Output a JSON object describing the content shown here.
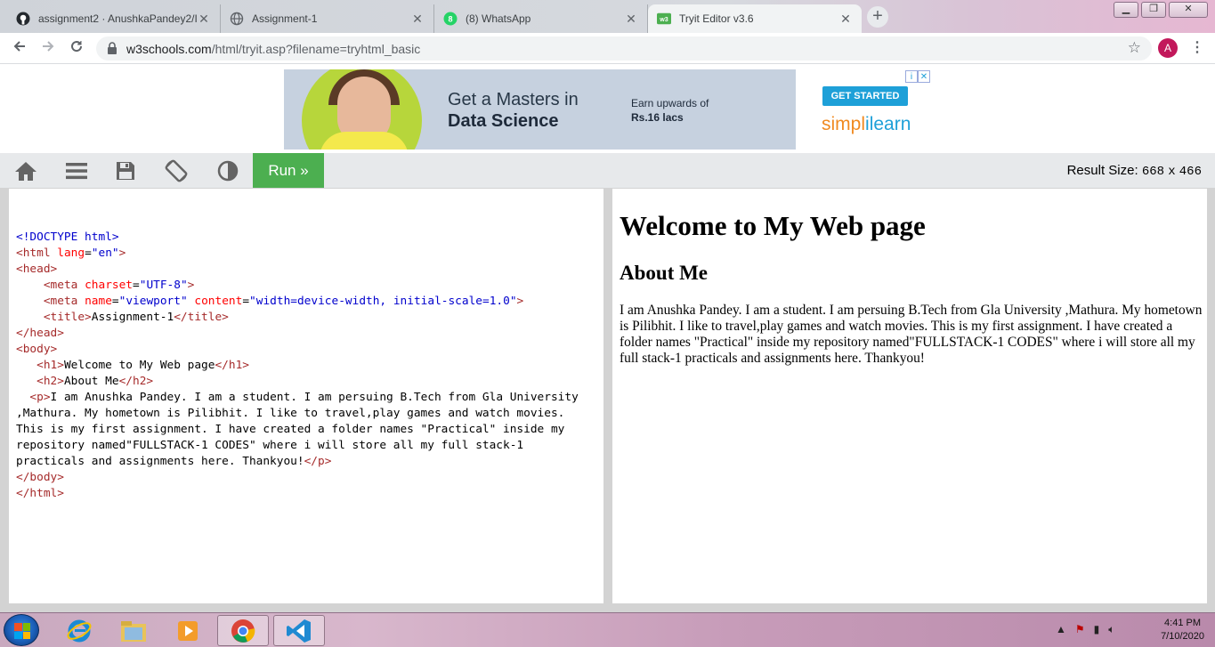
{
  "browser": {
    "tabs": [
      {
        "title": "assignment2 · AnushkaPandey2/I",
        "icon": "github-icon",
        "active": false
      },
      {
        "title": "Assignment-1",
        "icon": "globe-icon",
        "active": false
      },
      {
        "title": "(8) WhatsApp",
        "icon": "whatsapp-icon",
        "active": false
      },
      {
        "title": "Tryit Editor v3.6",
        "icon": "w3schools-icon",
        "active": true
      }
    ],
    "url_host": "w3schools.com",
    "url_path": "/html/tryit.asp?filename=tryhtml_basic",
    "profile_initial": "A"
  },
  "ad": {
    "headline_1": "Get a Masters in",
    "headline_2": "Data Science",
    "earn_line_1": "Earn upwards of",
    "earn_line_2": "Rs.16 lacs",
    "cta": "GET STARTED",
    "brand_1": "simpl",
    "brand_2": "i",
    "brand_3": "learn"
  },
  "tryit": {
    "run_label": "Run »",
    "result_size_label": "Result Size:",
    "result_width": "668",
    "result_times": "x",
    "result_height": "466"
  },
  "code": {
    "doctype": "<!DOCTYPE html>",
    "html_open_tag": "<html",
    "html_lang_attr": "lang",
    "html_lang_val": "\"en\"",
    "gt": ">",
    "eq": "=",
    "head_open": "<head>",
    "meta": "<meta",
    "charset_attr": "charset",
    "charset_val": "\"UTF-8\"",
    "name_attr": "name",
    "name_val": "\"viewport\"",
    "content_attr": "content",
    "content_val": "\"width=device-width, initial-scale=1.0\"",
    "title_open": "<title>",
    "title_text": "Assignment-1",
    "title_close": "</title>",
    "head_close": "</head>",
    "body_open": "<body>",
    "h1_open": "<h1>",
    "h1_text": "Welcome to My Web page",
    "h1_close": "</h1>",
    "h2_open": "<h2>",
    "h2_text": "About Me",
    "h2_close": "</h2>",
    "p_open": "<p>",
    "p_text": "I am Anushka Pandey. I am a student. I am persuing B.Tech from Gla University ,Mathura. My hometown is Pilibhit. I like to travel,play games and watch movies.  This is my first assignment. I have created a folder names \"Practical\" inside my repository named\"FULLSTACK-1 CODES\" where i will store all my full stack-1 practicals and assignments here. Thankyou!",
    "p_close": "</p>",
    "body_close": "</body>",
    "html_close": "</html>"
  },
  "result": {
    "h1": "Welcome to My Web page",
    "h2": "About Me",
    "p": "I am Anushka Pandey. I am a student. I am persuing B.Tech from Gla University ,Mathura. My hometown is Pilibhit. I like to travel,play games and watch movies. This is my first assignment. I have created a folder names \"Practical\" inside my repository named\"FULLSTACK-1 CODES\" where i will store all my full stack-1 practicals and assignments here. Thankyou!"
  },
  "taskbar": {
    "time": "4:41 PM",
    "date": "7/10/2020"
  }
}
